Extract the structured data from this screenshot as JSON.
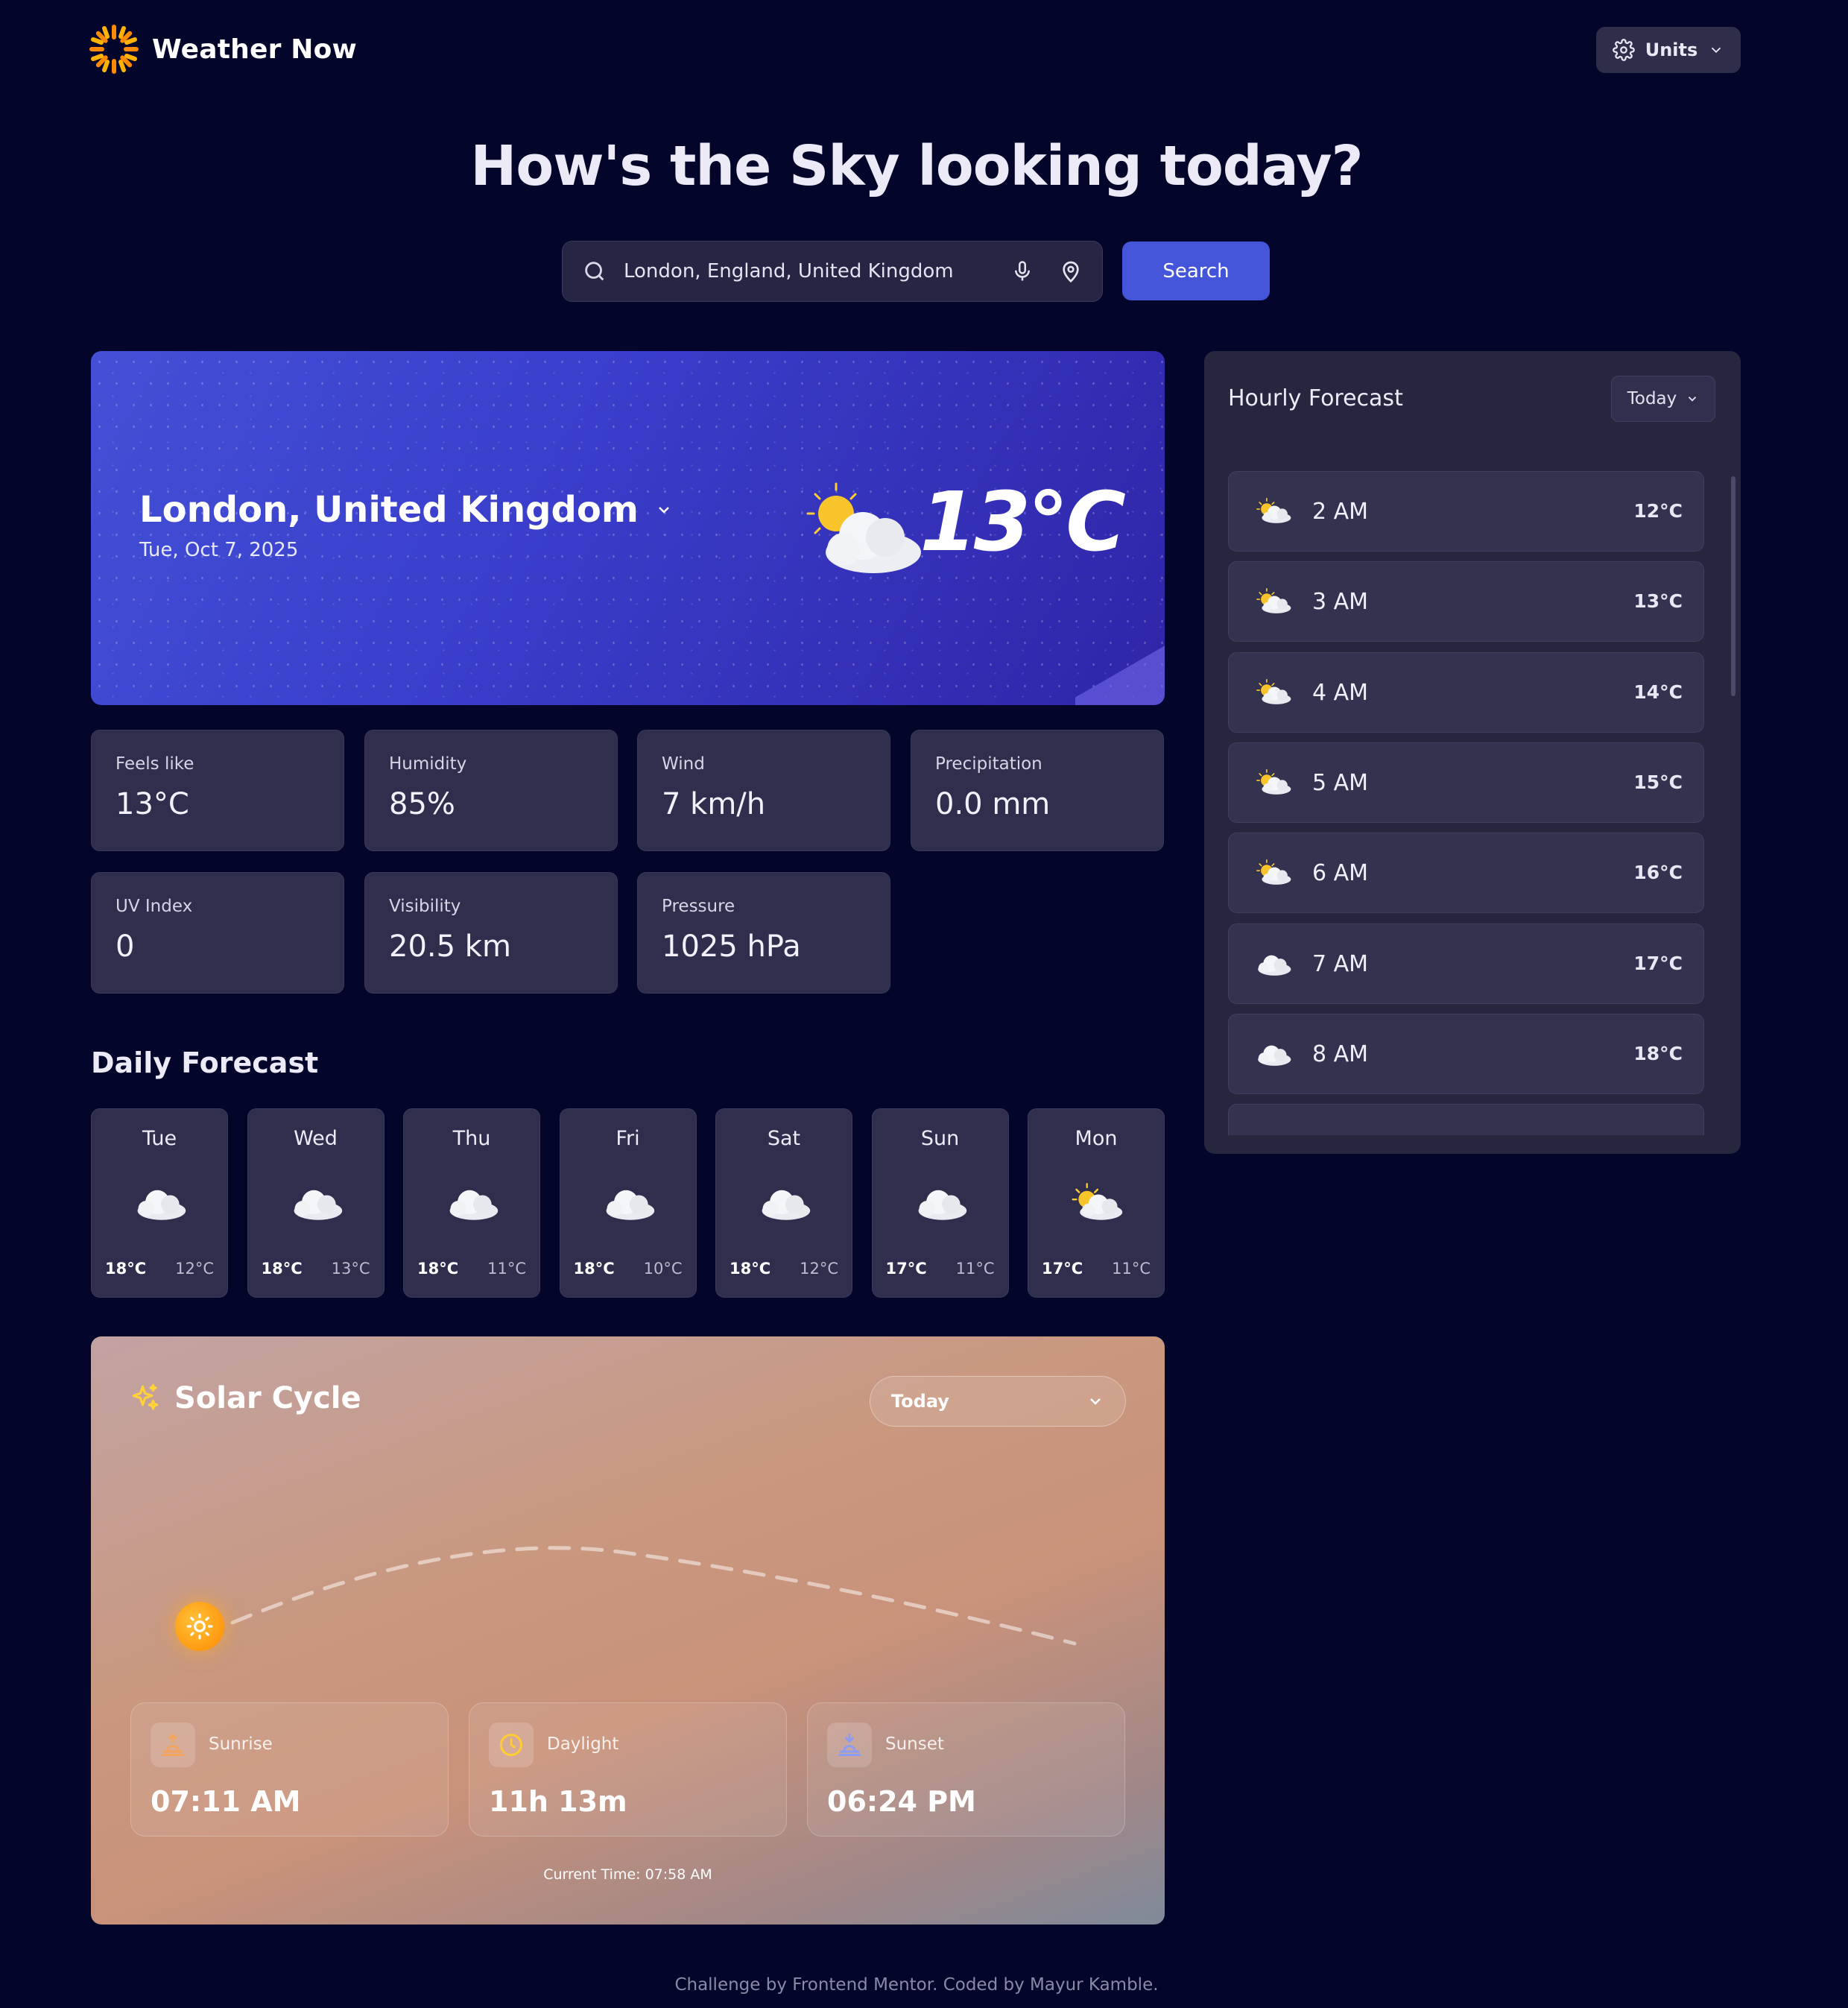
{
  "app": {
    "title": "Weather Now",
    "units_label": "Units"
  },
  "hero_title": "How's the Sky looking today?",
  "search": {
    "query": "London, England, United Kingdom",
    "button": "Search"
  },
  "current": {
    "location": "London, United Kingdom",
    "date": "Tue, Oct 7, 2025",
    "temp": "13°C",
    "icon": "partly-cloudy-icon"
  },
  "stats": [
    {
      "label": "Feels like",
      "value": "13°C"
    },
    {
      "label": "Humidity",
      "value": "85%"
    },
    {
      "label": "Wind",
      "value": "7 km/h"
    },
    {
      "label": "Precipitation",
      "value": "0.0 mm"
    },
    {
      "label": "UV Index",
      "value": "0"
    },
    {
      "label": "Visibility",
      "value": "20.5 km"
    },
    {
      "label": "Pressure",
      "value": "1025 hPa"
    }
  ],
  "daily": {
    "title": "Daily Forecast",
    "days": [
      {
        "name": "Tue",
        "hi": "18°C",
        "lo": "12°C",
        "icon": "cloud-icon"
      },
      {
        "name": "Wed",
        "hi": "18°C",
        "lo": "13°C",
        "icon": "cloud-icon"
      },
      {
        "name": "Thu",
        "hi": "18°C",
        "lo": "11°C",
        "icon": "cloud-icon"
      },
      {
        "name": "Fri",
        "hi": "18°C",
        "lo": "10°C",
        "icon": "cloud-icon"
      },
      {
        "name": "Sat",
        "hi": "18°C",
        "lo": "12°C",
        "icon": "cloud-icon"
      },
      {
        "name": "Sun",
        "hi": "17°C",
        "lo": "11°C",
        "icon": "cloud-icon"
      },
      {
        "name": "Mon",
        "hi": "17°C",
        "lo": "11°C",
        "icon": "partly-cloudy-icon"
      }
    ]
  },
  "hourly": {
    "title": "Hourly Forecast",
    "day_select": "Today",
    "hours": [
      {
        "time": "2 AM",
        "temp": "12°C",
        "icon": "partly-cloudy-icon"
      },
      {
        "time": "3 AM",
        "temp": "13°C",
        "icon": "partly-cloudy-icon"
      },
      {
        "time": "4 AM",
        "temp": "14°C",
        "icon": "partly-cloudy-icon"
      },
      {
        "time": "5 AM",
        "temp": "15°C",
        "icon": "partly-cloudy-icon"
      },
      {
        "time": "6 AM",
        "temp": "16°C",
        "icon": "partly-cloudy-icon"
      },
      {
        "time": "7 AM",
        "temp": "17°C",
        "icon": "cloud-icon"
      },
      {
        "time": "8 AM",
        "temp": "18°C",
        "icon": "cloud-icon"
      }
    ]
  },
  "solar": {
    "title": "Solar Cycle",
    "day_select": "Today",
    "sunrise_label": "Sunrise",
    "sunrise": "07:11 AM",
    "daylight_label": "Daylight",
    "daylight": "11h 13m",
    "sunset_label": "Sunset",
    "sunset": "06:24 PM",
    "current_time": "Current Time: 07:58 AM"
  },
  "footer": "Challenge by Frontend Mentor. Coded by Mayur Kamble.",
  "colors": {
    "background": "#03052b",
    "accent": "#4455da",
    "card": "#2f2e4c",
    "sun": "#ff9a10"
  }
}
